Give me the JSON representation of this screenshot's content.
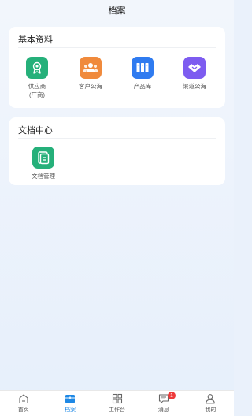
{
  "header": {
    "title": "档案"
  },
  "sections": [
    {
      "title": "基本资料",
      "items": [
        {
          "label": "供应商\n(厂商)",
          "color": "#25b07a",
          "icon": "ribbon-badge-icon"
        },
        {
          "label": "客户公海",
          "color": "#f08a3c",
          "icon": "users-group-icon"
        },
        {
          "label": "产品库",
          "color": "#2f7bf0",
          "icon": "books-icon"
        },
        {
          "label": "渠道公海",
          "color": "#7d5cf0",
          "icon": "handshake-icon"
        }
      ]
    },
    {
      "title": "文档中心",
      "items": [
        {
          "label": "文档管理",
          "color": "#25b07a",
          "icon": "documents-icon"
        }
      ]
    }
  ],
  "tabbar": {
    "active": "档案",
    "accent": "#1e88e5",
    "items": [
      {
        "label": "首页",
        "icon": "home-icon"
      },
      {
        "label": "档案",
        "icon": "archive-icon"
      },
      {
        "label": "工作台",
        "icon": "grid-icon"
      },
      {
        "label": "消息",
        "icon": "message-icon",
        "badge": "1"
      },
      {
        "label": "我的",
        "icon": "user-icon"
      }
    ]
  }
}
